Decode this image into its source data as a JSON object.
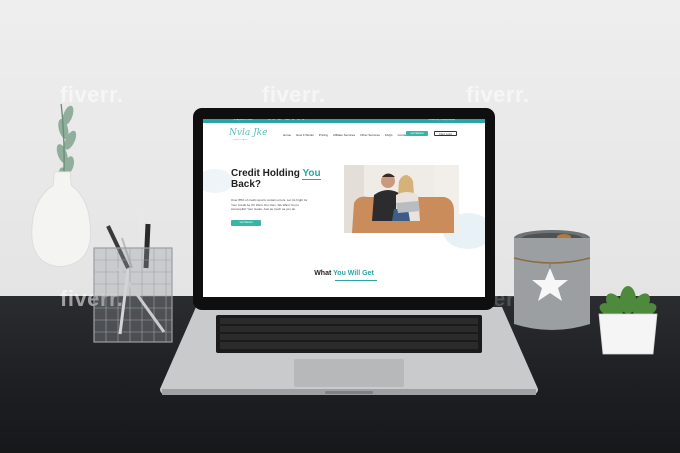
{
  "watermark": "fiverr.",
  "website": {
    "topbar": {
      "left": "f in  ☎ phone  ✉ email",
      "right": "contact info  |  credit@example"
    },
    "logo": {
      "name": "Nvla Jke",
      "tagline": "credit repair"
    },
    "nav": {
      "links": [
        "Home",
        "How It Works",
        "Pricing",
        "Affiliate Services",
        "Other Services",
        "FAQs",
        "Contact"
      ],
      "cta_primary": "Get Started",
      "cta_secondary": "Client Login"
    },
    "hero": {
      "title_part1": "Credit Holding ",
      "title_accent": "You",
      "title_part2": " Back?",
      "text": "Over 85% of credit reports contain errors. Let Us Fight for Your Credit As If It Were Our Own. We Want You to Accomplish Your Goals. Just as much as you do.",
      "button": "Get Started"
    },
    "section": {
      "title_part1": "What ",
      "title_accent": "You Will Get"
    }
  },
  "colors": {
    "accent": "#2aa6a6",
    "button": "#3ab5a5",
    "desk": "#1d1e21",
    "wall": "#e9e9e9"
  }
}
